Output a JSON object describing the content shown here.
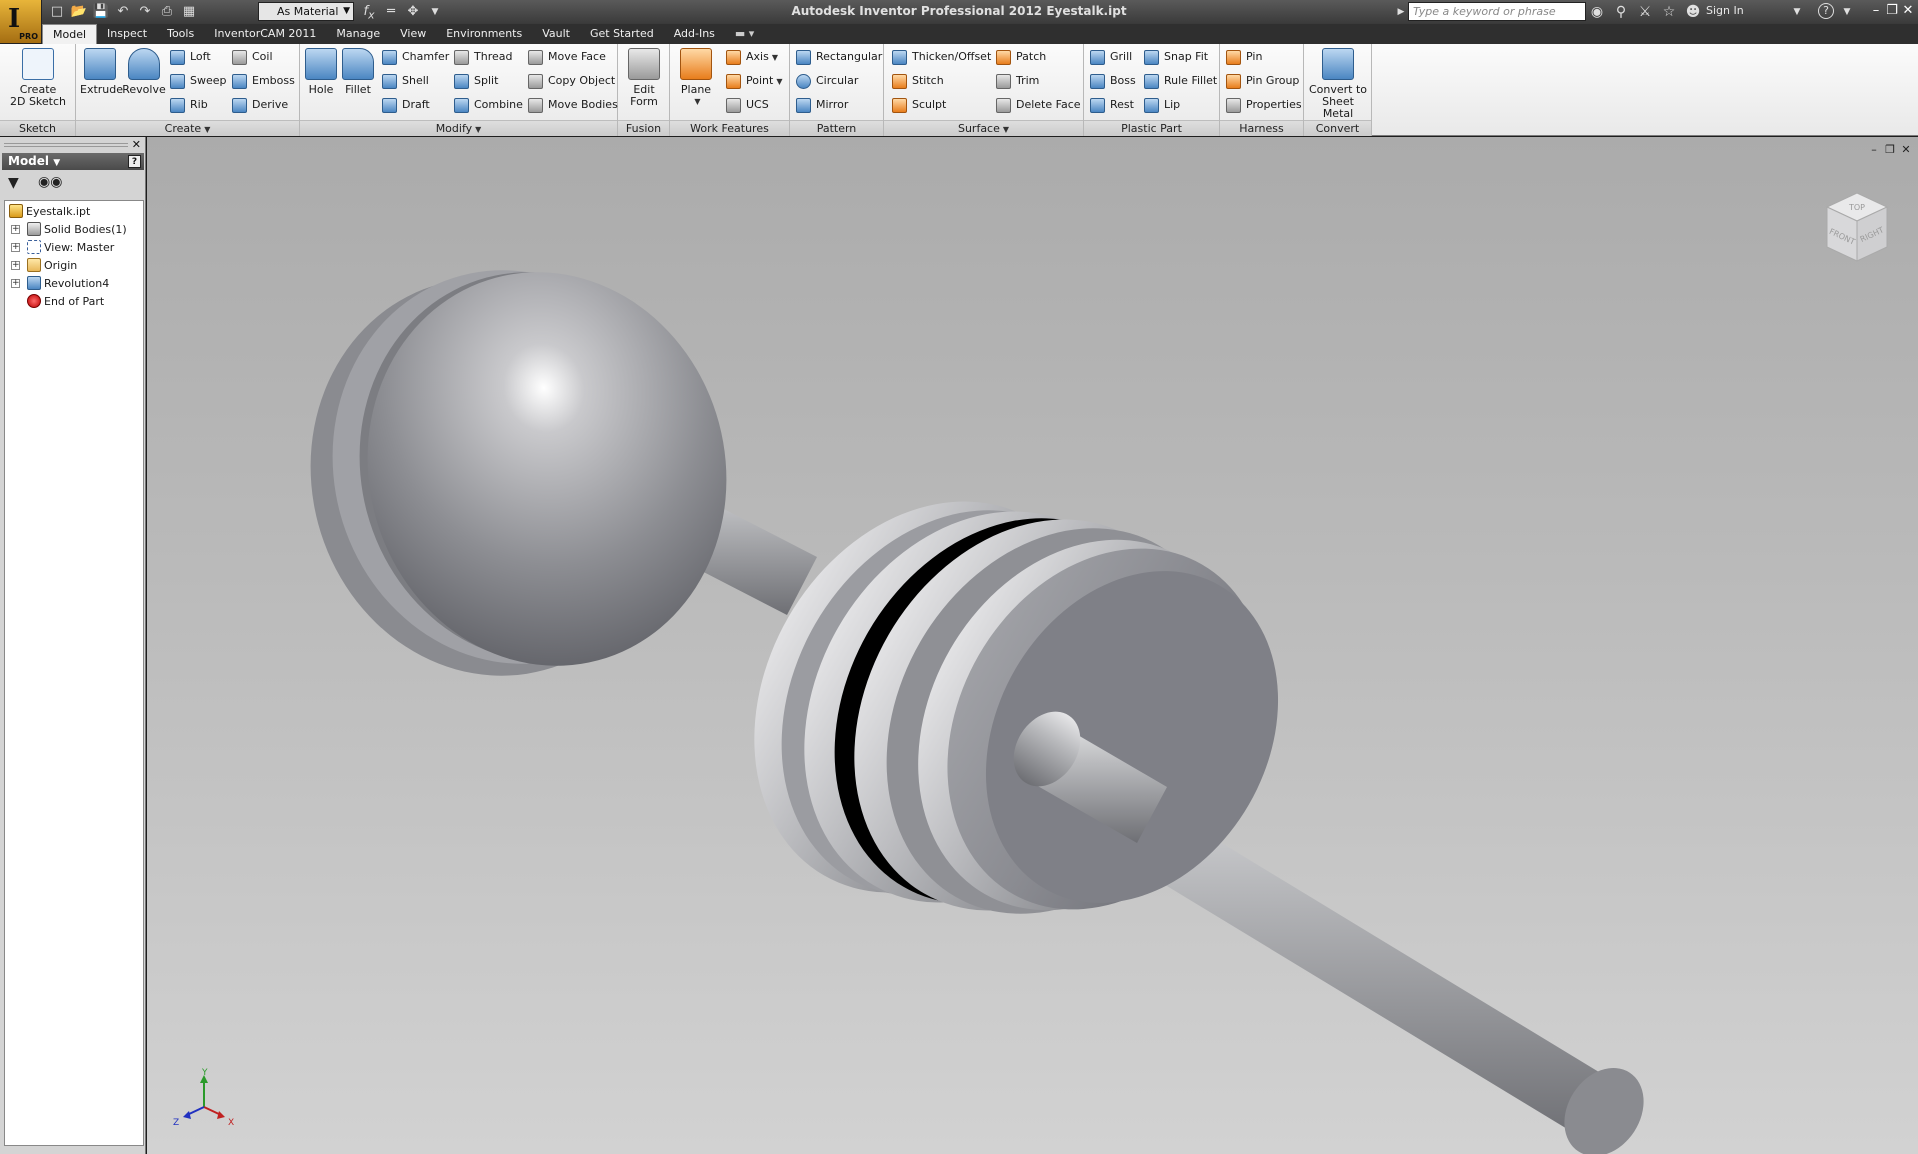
{
  "app": {
    "logo_letter": "I",
    "edition_badge": "PRO",
    "window_title": "Autodesk Inventor Professional 2012   Eyestalk.ipt",
    "material_select": "As Material",
    "search_placeholder": "Type a keyword or phrase",
    "sign_in": "Sign In",
    "help_icon": "?"
  },
  "tabs": [
    "Model",
    "Inspect",
    "Tools",
    "InventorCAM 2011",
    "Manage",
    "View",
    "Environments",
    "Vault",
    "Get Started",
    "Add-Ins"
  ],
  "active_tab": "Model",
  "ribbon": {
    "sketch": {
      "title": "Sketch",
      "create_2d_sketch": "Create\n2D Sketch"
    },
    "create": {
      "title": "Create",
      "extrude": "Extrude",
      "revolve": "Revolve",
      "loft": "Loft",
      "sweep": "Sweep",
      "rib": "Rib",
      "coil": "Coil",
      "emboss": "Emboss",
      "derive": "Derive"
    },
    "modify": {
      "title": "Modify",
      "hole": "Hole",
      "fillet": "Fillet",
      "chamfer": "Chamfer",
      "shell": "Shell",
      "draft": "Draft",
      "thread": "Thread",
      "split": "Split",
      "combine": "Combine",
      "move_face": "Move Face",
      "copy_object": "Copy Object",
      "move_bodies": "Move Bodies"
    },
    "fusion": {
      "title": "Fusion",
      "edit_form": "Edit\nForm"
    },
    "work_features": {
      "title": "Work Features",
      "plane": "Plane",
      "axis": "Axis",
      "point": "Point",
      "ucs": "UCS"
    },
    "pattern": {
      "title": "Pattern",
      "rectangular": "Rectangular",
      "circular": "Circular",
      "mirror": "Mirror"
    },
    "surface": {
      "title": "Surface",
      "thicken_offset": "Thicken/Offset",
      "stitch": "Stitch",
      "sculpt": "Sculpt",
      "patch": "Patch",
      "trim": "Trim",
      "delete_face": "Delete Face"
    },
    "plastic_part": {
      "title": "Plastic Part",
      "grill": "Grill",
      "boss": "Boss",
      "rest": "Rest",
      "snap_fit": "Snap Fit",
      "rule_fillet": "Rule Fillet",
      "lip": "Lip"
    },
    "harness": {
      "title": "Harness",
      "pin": "Pin",
      "pin_group": "Pin Group",
      "properties": "Properties"
    },
    "convert": {
      "title": "Convert",
      "convert_to_sheet_metal": "Convert to\nSheet Metal"
    }
  },
  "browser": {
    "title": "Model",
    "help": "?",
    "tree": [
      {
        "label": "Eyestalk.ipt",
        "icon": "part-icon"
      },
      {
        "label": "Solid Bodies(1)",
        "icon": "solid-bodies-icon"
      },
      {
        "label": "View: Master",
        "icon": "view-rep-icon"
      },
      {
        "label": "Origin",
        "icon": "folder-icon"
      },
      {
        "label": "Revolution4",
        "icon": "revolve-feature-icon"
      },
      {
        "label": "End of Part",
        "icon": "end-of-part-icon"
      }
    ]
  },
  "viewcube": {
    "top": "TOP",
    "front": "FRONT",
    "right": "RIGHT"
  },
  "triad": {
    "x": "X",
    "y": "Y",
    "z": "Z"
  },
  "colors": {
    "accent_orange": "#e8a43a",
    "model_gray": "#8e8f94",
    "ribbon_bg": "#f1f1f1",
    "titlebar": "#3c3c3c"
  }
}
